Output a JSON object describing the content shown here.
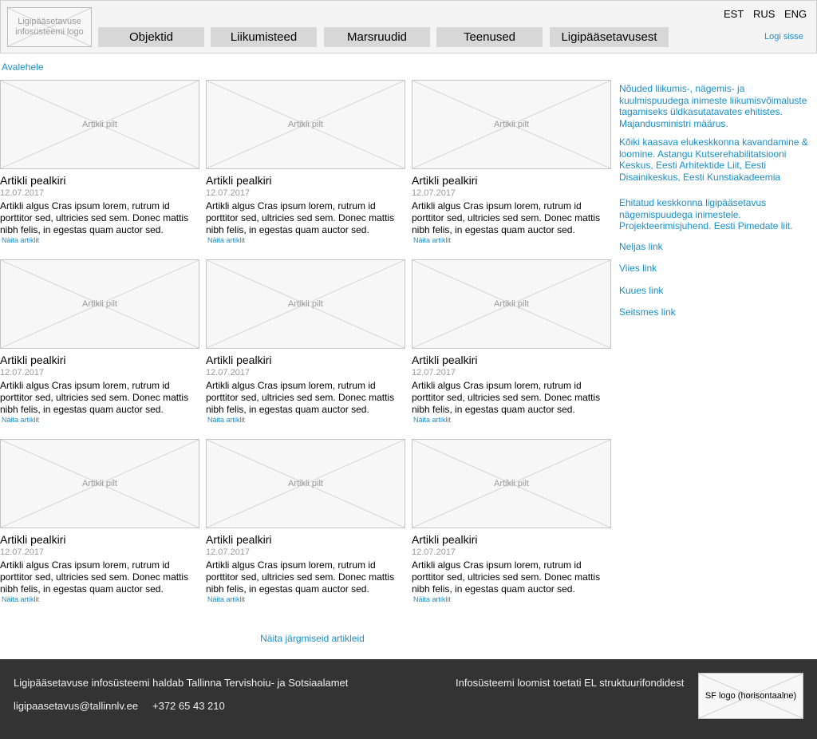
{
  "header": {
    "logo_text": "Ligipääsetavuse infosüsteemi logo",
    "nav": [
      {
        "label": "Objektid"
      },
      {
        "label": "Liikumisteed"
      },
      {
        "label": "Marsruudid"
      },
      {
        "label": "Teenused"
      },
      {
        "label": "Ligipääsetavusest"
      }
    ],
    "languages": [
      "EST",
      "RUS",
      "ENG"
    ],
    "login_label": "Logi sisse"
  },
  "breadcrumb": "Avalehele",
  "articles": [
    {
      "image_label": "Artikli pilt",
      "title": "Artikli pealkiri",
      "date": "12.07.2017",
      "excerpt": "Artikli algus Cras ipsum lorem, rutrum id porttitor sed, ultricies sed sem. Donec mattis nibh felis, in egestas quam auctor sed.",
      "link": "Näita artiklit"
    },
    {
      "image_label": "Artikli pilt",
      "title": "Artikli pealkiri",
      "date": "12.07.2017",
      "excerpt": "Artikli algus Cras ipsum lorem, rutrum id porttitor sed, ultricies sed sem. Donec mattis nibh felis, in egestas quam auctor sed.",
      "link": "Näita artiklit"
    },
    {
      "image_label": "Artikli pilt",
      "title": "Artikli pealkiri",
      "date": "12.07.2017",
      "excerpt": "Artikli algus Cras ipsum lorem, rutrum id porttitor sed, ultricies sed sem. Donec mattis nibh felis, in egestas quam auctor sed.",
      "link": "Näita artiklit"
    },
    {
      "image_label": "Artikli pilt",
      "title": "Artikli pealkiri",
      "date": "12.07.2017",
      "excerpt": "Artikli algus Cras ipsum lorem, rutrum id porttitor sed, ultricies sed sem. Donec mattis nibh felis, in egestas quam auctor sed.",
      "link": "Näita artiklit"
    },
    {
      "image_label": "Artikli pilt",
      "title": "Artikli pealkiri",
      "date": "12.07.2017",
      "excerpt": "Artikli algus Cras ipsum lorem, rutrum id porttitor sed, ultricies sed sem. Donec mattis nibh felis, in egestas quam auctor sed.",
      "link": "Näita artiklit"
    },
    {
      "image_label": "Artikli pilt",
      "title": "Artikli pealkiri",
      "date": "12.07.2017",
      "excerpt": "Artikli algus Cras ipsum lorem, rutrum id porttitor sed, ultricies sed sem. Donec mattis nibh felis, in egestas quam auctor sed.",
      "link": "Näita artiklit"
    },
    {
      "image_label": "Artikli pilt",
      "title": "Artikli pealkiri",
      "date": "12.07.2017",
      "excerpt": "Artikli algus Cras ipsum lorem, rutrum id porttitor sed, ultricies sed sem. Donec mattis nibh felis, in egestas quam auctor sed.",
      "link": "Näita artiklit"
    },
    {
      "image_label": "Artikli pilt",
      "title": "Artikli pealkiri",
      "date": "12.07.2017",
      "excerpt": "Artikli algus Cras ipsum lorem, rutrum id porttitor sed, ultricies sed sem. Donec mattis nibh felis, in egestas quam auctor sed.",
      "link": "Näita artiklit"
    },
    {
      "image_label": "Artikli pilt",
      "title": "Artikli pealkiri",
      "date": "12.07.2017",
      "excerpt": "Artikli algus Cras ipsum lorem, rutrum id porttitor sed, ultricies sed sem. Donec mattis nibh felis, in egestas quam auctor sed.",
      "link": "Näita artiklit"
    }
  ],
  "sidebar": {
    "links": [
      "Nõuded liikumis-, nägemis- ja kuulmispuudega inimeste liikumisvõimaluste tagamiseks üldkasutatavates ehitistes. Majandusministri määrus.",
      "Kõiki kaasava elukeskkonna kavandamine & loomine. Astangu Kutserehabilitatsiooni Keskus, Eesti Arhitektide Liit, Eesti Disainikeskus, Eesti Kunstiakadeemia",
      "Ehitatud keskkonna ligipääsetavus nägemispuudega inimestele. Projekteerimisjuhend. Eesti Pimedate liit.",
      "Neljas link",
      "Viies link",
      "Kuues link",
      "Seitsmes link"
    ]
  },
  "more_articles": "Näita järgmiseid artikleid",
  "footer": {
    "maintainer": "Ligipääsetavuse infosüsteemi haldab Tallinna Tervishoiu- ja Sotsiaalamet",
    "email": "ligipaasetavus@tallinnlv.ee",
    "phone": "+372 65 43 210",
    "funding": "Infosüsteemi loomist toetati EL struktuurifondidest",
    "sf_logo_text": "SF logo (horisontaalne)"
  },
  "colors": {
    "link": "#1a8fc9",
    "nav_button": "#d7d7d7",
    "header_bg": "#f4f4f4",
    "footer_bg": "#333333"
  }
}
